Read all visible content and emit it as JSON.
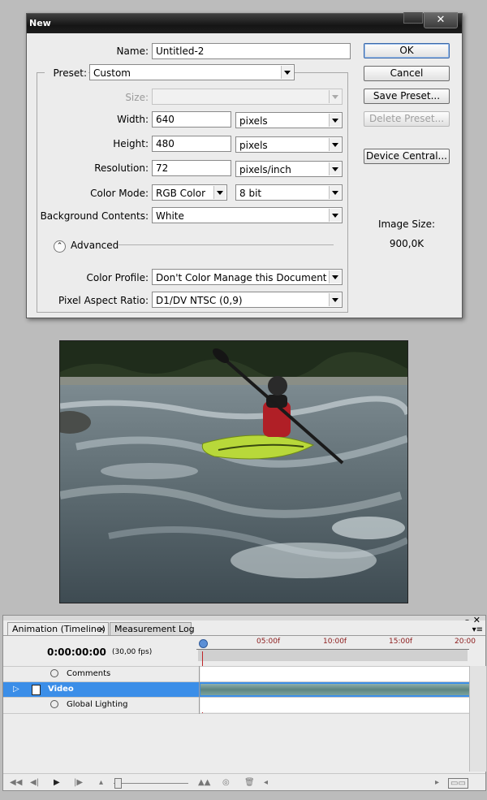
{
  "dialog": {
    "title": "New",
    "close_glyph": "✕",
    "name_label": "Name:",
    "name_value": "Untitled-2",
    "preset_label": "Preset:",
    "preset_value": "Custom",
    "size_label": "Size:",
    "width_label": "Width:",
    "width_value": "640",
    "width_unit": "pixels",
    "height_label": "Height:",
    "height_value": "480",
    "height_unit": "pixels",
    "resolution_label": "Resolution:",
    "resolution_value": "72",
    "resolution_unit": "pixels/inch",
    "color_mode_label": "Color Mode:",
    "color_mode_value": "RGB Color",
    "bit_depth_value": "8 bit",
    "background_label": "Background Contents:",
    "background_value": "White",
    "advanced_label": "Advanced",
    "color_profile_label": "Color Profile:",
    "color_profile_value": "Don't Color Manage this Document",
    "pixel_aspect_label": "Pixel Aspect Ratio:",
    "pixel_aspect_value": "D1/DV NTSC (0,9)",
    "buttons": {
      "ok": "OK",
      "cancel": "Cancel",
      "save_preset": "Save Preset...",
      "delete_preset": "Delete Preset...",
      "device_central": "Device Central..."
    },
    "image_size_label": "Image Size:",
    "image_size_value": "900,0K"
  },
  "timeline": {
    "tabs": [
      "Animation (Timeline)",
      "Measurement Log"
    ],
    "tab_close_glyph": "×",
    "timecode": "0:00:00:00",
    "fps": "(30,00 fps)",
    "ruler_labels": [
      "05:00f",
      "10:00f",
      "15:00f",
      "20:00"
    ],
    "layers": [
      {
        "name": "Comments"
      },
      {
        "name": "Video"
      },
      {
        "name": "Global Lighting"
      }
    ]
  }
}
